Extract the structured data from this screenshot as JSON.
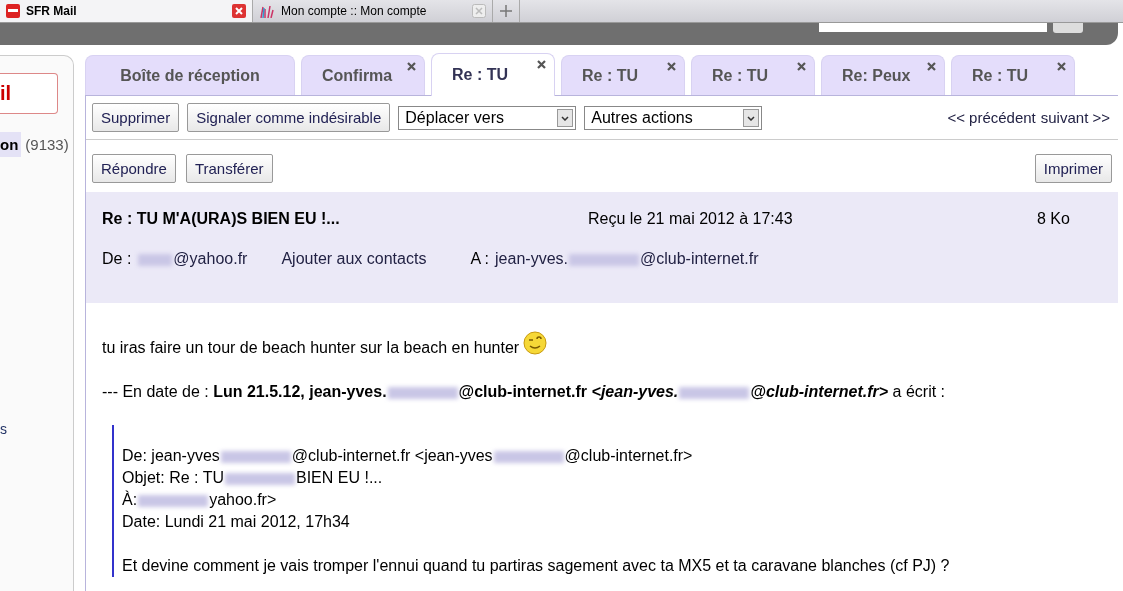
{
  "browser_tabs": [
    {
      "title": "SFR Mail",
      "selected": true
    },
    {
      "title": "Mon compte :: Mon compte",
      "selected": false
    }
  ],
  "sidebar": {
    "compose_button": "il",
    "folder": {
      "name": "on",
      "count": "(9133)",
      "selected": true
    },
    "link": "s"
  },
  "mail_tabs": [
    {
      "label": "Boîte de réception",
      "selected": false,
      "closable": false
    },
    {
      "label": "Confirma",
      "selected": false,
      "closable": true
    },
    {
      "label": "Re : TU",
      "selected": true,
      "closable": true
    },
    {
      "label": "Re : TU",
      "selected": false,
      "closable": true
    },
    {
      "label": "Re : TU",
      "selected": false,
      "closable": true
    },
    {
      "label": "Re: Peux",
      "selected": false,
      "closable": true
    },
    {
      "label": "Re : TU",
      "selected": false,
      "closable": true
    }
  ],
  "toolbar": {
    "buttons": [
      "Supprimer",
      "Signaler comme indésirable"
    ],
    "dropdowns": [
      "Déplacer vers",
      "Autres actions"
    ],
    "nav_links": [
      "<< précédent",
      "suivant >>"
    ]
  },
  "actions": {
    "left": [
      "Répondre",
      "Transférer"
    ],
    "right": [
      "Imprimer"
    ]
  },
  "message": {
    "subject": "Re : TU M'A(URA)S BIEN EU !...",
    "received": "Reçu le 21 mai 2012 à 17:43",
    "size": "8 Ko",
    "from_label": "De :",
    "from": [
      {
        "kind": "blur"
      },
      {
        "kind": "text",
        "text": "@yahoo.fr"
      }
    ],
    "add_contact": "Ajouter aux contacts",
    "to_label": "A :",
    "to": [
      {
        "kind": "text",
        "text": "jean-yves."
      },
      {
        "kind": "blur"
      },
      {
        "kind": "text",
        "text": "@club-internet.fr"
      }
    ]
  },
  "body": [
    {
      "kind": "para",
      "segments": [
        {
          "kind": "text",
          "text": "tu iras faire un tour de beach hunter sur la beach en hunter"
        },
        {
          "kind": "smiley"
        }
      ]
    },
    {
      "kind": "para",
      "segments": [
        {
          "kind": "text",
          "text": "--- En date de : **Lun 21.5.12, jean-yves.**"
        },
        {
          "kind": "blur"
        },
        {
          "kind": "text",
          "text": "**@club-internet.fr**"
        },
        {
          "kind": "emphasis",
          "text": "<jean-yves."
        },
        {
          "kind": "blur"
        },
        {
          "kind": "emphasis",
          "text": "@club-internet.fr>"
        },
        {
          "kind": "text",
          "text": "a écrit :"
        }
      ]
    },
    {
      "kind": "quote",
      "lines": [
        [
          {
            "kind": "text",
            "text": "De: jean-yves"
          },
          {
            "kind": "blur"
          },
          {
            "kind": "text",
            "text": "@club-internet.fr <jean-yves"
          },
          {
            "kind": "blur"
          },
          {
            "kind": "text",
            "text": "@club-internet.fr>"
          }
        ],
        [
          {
            "kind": "text",
            "text": "Objet: Re : TU"
          },
          {
            "kind": "blur"
          },
          {
            "kind": "text",
            "text": "BIEN EU !..."
          }
        ],
        [
          {
            "kind": "text",
            "text": "À:"
          },
          {
            "kind": "blur"
          },
          {
            "kind": "text",
            "text": "yahoo.fr>"
          }
        ],
        [
          {
            "kind": "text",
            "text": "Date: Lundi 21 mai 2012, 17h34"
          }
        ]
      ],
      "text": [
        {
          "kind": "text",
          "text": "Et devine comment je vais tromper l'ennui quand tu partiras sagement avec ta MX5 et ta caravane blanches (cf PJ) ?"
        }
      ]
    }
  ]
}
